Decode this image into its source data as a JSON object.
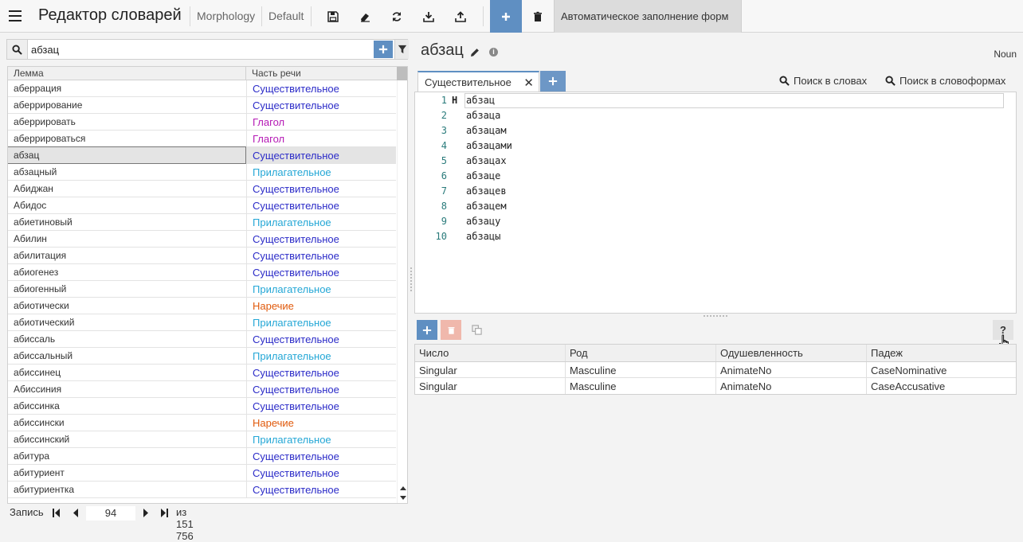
{
  "header": {
    "title": "Редактор словарей",
    "crumb1": "Morphology",
    "crumb2": "Default",
    "autofill_label": "Автоматическое заполнение форм"
  },
  "left": {
    "search_value": "абзац",
    "columns": [
      "Лемма",
      "Часть речи"
    ],
    "rows": [
      {
        "lemma": "аберрация",
        "pos": "Существительное",
        "kind": "noun"
      },
      {
        "lemma": "аберрирование",
        "pos": "Существительное",
        "kind": "noun"
      },
      {
        "lemma": "аберрировать",
        "pos": "Глагол",
        "kind": "verb"
      },
      {
        "lemma": "аберрироваться",
        "pos": "Глагол",
        "kind": "verb"
      },
      {
        "lemma": "абзац",
        "pos": "Существительное",
        "kind": "noun",
        "selected": true
      },
      {
        "lemma": "абзацный",
        "pos": "Прилагательное",
        "kind": "adj"
      },
      {
        "lemma": "Абиджан",
        "pos": "Существительное",
        "kind": "noun"
      },
      {
        "lemma": "Абидос",
        "pos": "Существительное",
        "kind": "noun"
      },
      {
        "lemma": "абиетиновый",
        "pos": "Прилагательное",
        "kind": "adj"
      },
      {
        "lemma": "Абилин",
        "pos": "Существительное",
        "kind": "noun"
      },
      {
        "lemma": "абилитация",
        "pos": "Существительное",
        "kind": "noun"
      },
      {
        "lemma": "абиогенез",
        "pos": "Существительное",
        "kind": "noun"
      },
      {
        "lemma": "абиогенный",
        "pos": "Прилагательное",
        "kind": "adj"
      },
      {
        "lemma": "абиотически",
        "pos": "Наречие",
        "kind": "adv"
      },
      {
        "lemma": "абиотический",
        "pos": "Прилагательное",
        "kind": "adj"
      },
      {
        "lemma": "абиссаль",
        "pos": "Существительное",
        "kind": "noun"
      },
      {
        "lemma": "абиссальный",
        "pos": "Прилагательное",
        "kind": "adj"
      },
      {
        "lemma": "абиссинец",
        "pos": "Существительное",
        "kind": "noun"
      },
      {
        "lemma": "Абиссиния",
        "pos": "Существительное",
        "kind": "noun"
      },
      {
        "lemma": "абиссинка",
        "pos": "Существительное",
        "kind": "noun"
      },
      {
        "lemma": "абиссински",
        "pos": "Наречие",
        "kind": "adv"
      },
      {
        "lemma": "абиссинский",
        "pos": "Прилагательное",
        "kind": "adj"
      },
      {
        "lemma": "абитура",
        "pos": "Существительное",
        "kind": "noun"
      },
      {
        "lemma": "абитуриент",
        "pos": "Существительное",
        "kind": "noun"
      },
      {
        "lemma": "абитуриентка",
        "pos": "Существительное",
        "kind": "noun"
      }
    ],
    "pager": {
      "label": "Запись",
      "current": "94",
      "of_label": "из 151 756"
    }
  },
  "right": {
    "word": "абзац",
    "pos_tag": "Noun",
    "tab_label": "Существительное",
    "search_words": "Поиск в словах",
    "search_forms": "Поиск в словоформах",
    "lines": [
      {
        "n": "1",
        "mark": "H",
        "text": "абзац"
      },
      {
        "n": "2",
        "mark": "",
        "text": "абзаца"
      },
      {
        "n": "3",
        "mark": "",
        "text": "абзацам"
      },
      {
        "n": "4",
        "mark": "",
        "text": "абзацами"
      },
      {
        "n": "5",
        "mark": "",
        "text": "абзацах"
      },
      {
        "n": "6",
        "mark": "",
        "text": "абзаце"
      },
      {
        "n": "7",
        "mark": "",
        "text": "абзацев"
      },
      {
        "n": "8",
        "mark": "",
        "text": "абзацем"
      },
      {
        "n": "9",
        "mark": "",
        "text": "абзацу"
      },
      {
        "n": "10",
        "mark": "",
        "text": "абзацы"
      }
    ],
    "help_label": "?",
    "grammemes": {
      "columns": [
        "Число",
        "Род",
        "Одушевленность",
        "Падеж"
      ],
      "rows": [
        [
          "Singular",
          "Masculine",
          "AnimateNo",
          "CaseNominative"
        ],
        [
          "Singular",
          "Masculine",
          "AnimateNo",
          "CaseAccusative"
        ]
      ]
    }
  },
  "colors": {
    "accent": "#5f8fc2",
    "noun": "#2b2bc8",
    "verb": "#b519b5",
    "adj": "#24a7d6",
    "adv": "#e05a0c"
  }
}
